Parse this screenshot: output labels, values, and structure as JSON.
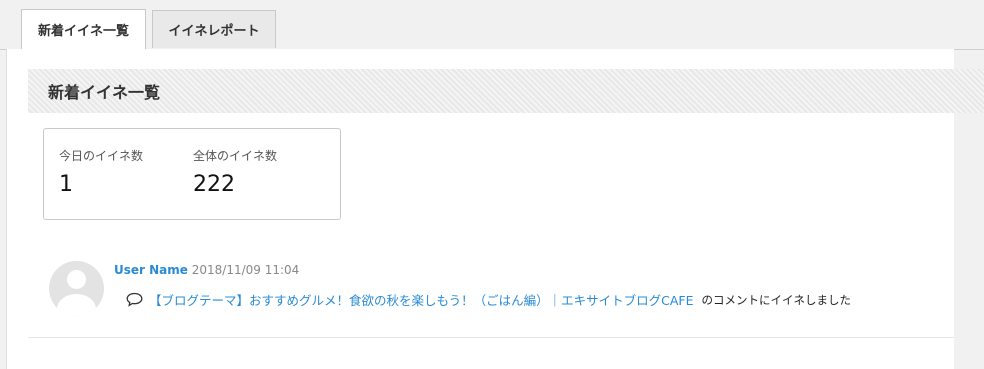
{
  "tabs": [
    {
      "label": "新着イイネ一覧",
      "active": true
    },
    {
      "label": "イイネレポート",
      "active": false
    }
  ],
  "section": {
    "title": "新着イイネ一覧"
  },
  "stats": {
    "today_label": "今日のイイネ数",
    "today_value": "1",
    "total_label": "全体のイイネ数",
    "total_value": "222"
  },
  "activities": [
    {
      "user": "User Name",
      "time": "2018/11/09 11:04",
      "icon": "comment-icon",
      "post_title": "【ブログテーマ】おすすめグルメ！食欲の秋を楽しもう！（ごはん編）｜エキサイトブログCAFE",
      "suffix": "のコメントにイイネしました"
    }
  ],
  "colors": {
    "link": "#2a8bd4",
    "header_bg": "#e8e8e8"
  }
}
